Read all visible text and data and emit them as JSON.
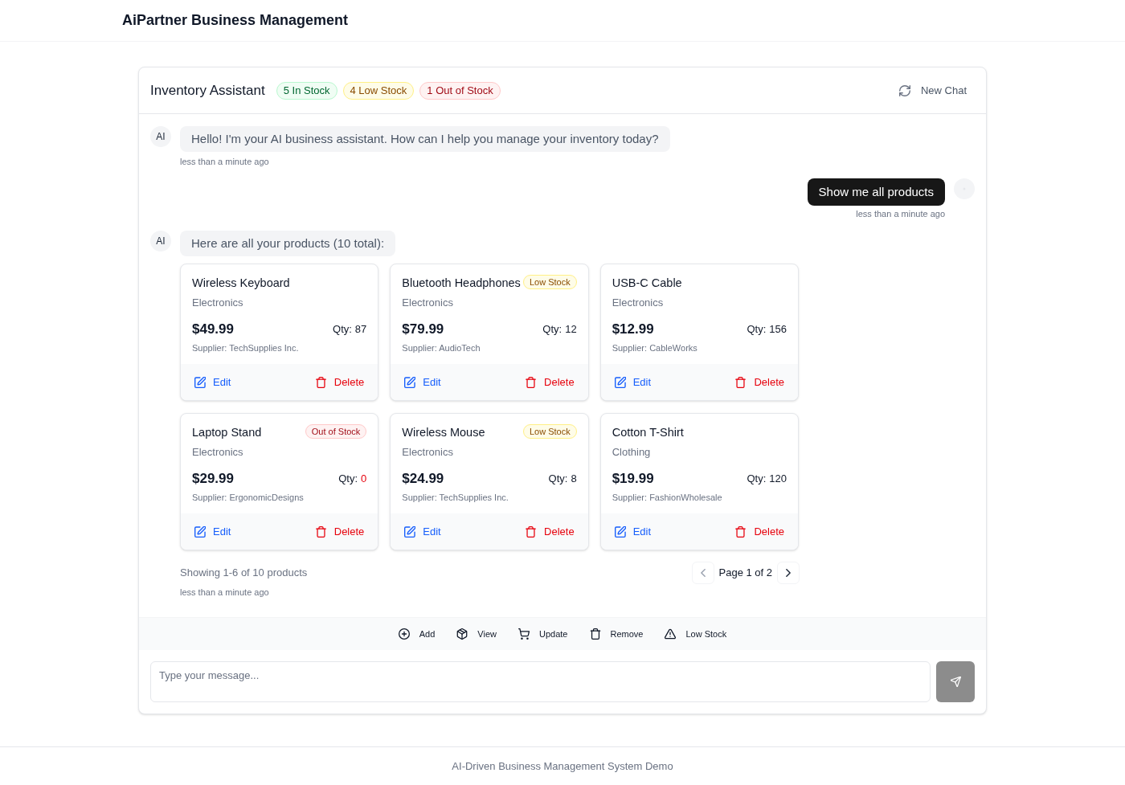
{
  "header": {
    "title": "AiPartner Business Management"
  },
  "chat": {
    "title": "Inventory Assistant",
    "stats": [
      {
        "kind": "in_stock",
        "label": "5 In Stock"
      },
      {
        "kind": "low_stock",
        "label": "4 Low Stock"
      },
      {
        "kind": "out_of_stock",
        "label": "1 Out of Stock"
      }
    ],
    "new_chat": {
      "label": "New Chat"
    }
  },
  "messages": [
    {
      "kind": "assistant",
      "avatar": "AI",
      "text": "Hello! I'm your AI business assistant. How can I help you manage your inventory today?",
      "time": "less than a minute ago"
    },
    {
      "kind": "user",
      "text": "Show me all products",
      "time": "less than a minute ago"
    },
    {
      "kind": "assistant",
      "avatar": "AI",
      "text": "Here are all your products (10 total):",
      "products": [
        {
          "kind": "in_stock",
          "name": "Wireless Keyboard",
          "category": "Electronics",
          "price": "$49.99",
          "qty_label": "Qty:",
          "qty": "87",
          "supplier": "Supplier: TechSupplies Inc.",
          "edit": "Edit",
          "delete": "Delete"
        },
        {
          "kind": "low_stock",
          "name": "Bluetooth Headphones",
          "badge": "Low Stock",
          "category": "Electronics",
          "price": "$79.99",
          "qty_label": "Qty:",
          "qty": "12",
          "supplier": "Supplier: AudioTech",
          "edit": "Edit",
          "delete": "Delete"
        },
        {
          "kind": "in_stock",
          "name": "USB-C Cable",
          "category": "Electronics",
          "price": "$12.99",
          "qty_label": "Qty:",
          "qty": "156",
          "supplier": "Supplier: CableWorks",
          "edit": "Edit",
          "delete": "Delete"
        },
        {
          "kind": "out_of_stock",
          "name": "Laptop Stand",
          "badge": "Out of Stock",
          "category": "Electronics",
          "price": "$29.99",
          "qty_label": "Qty:",
          "qty": "0",
          "supplier": "Supplier: ErgonomicDesigns",
          "edit": "Edit",
          "delete": "Delete"
        },
        {
          "kind": "low_stock",
          "name": "Wireless Mouse",
          "badge": "Low Stock",
          "category": "Electronics",
          "price": "$24.99",
          "qty_label": "Qty:",
          "qty": "8",
          "supplier": "Supplier: TechSupplies Inc.",
          "edit": "Edit",
          "delete": "Delete"
        },
        {
          "kind": "in_stock",
          "name": "Cotton T-Shirt",
          "category": "Clothing",
          "price": "$19.99",
          "qty_label": "Qty:",
          "qty": "120",
          "supplier": "Supplier: FashionWholesale",
          "edit": "Edit",
          "delete": "Delete"
        }
      ],
      "summary": "Showing 1-6 of 10 products",
      "pagination": {
        "label": "Page 1 of 2",
        "prev_disabled": true,
        "next_disabled": false
      },
      "time": "less than a minute ago"
    }
  ],
  "quick_actions": [
    {
      "kind": "add",
      "label": "Add"
    },
    {
      "kind": "view",
      "label": "View"
    },
    {
      "kind": "update",
      "label": "Update"
    },
    {
      "kind": "remove",
      "label": "Remove"
    },
    {
      "kind": "low_stock",
      "label": "Low Stock"
    }
  ],
  "composer": {
    "placeholder": "Type your message...",
    "send_disabled": true
  },
  "footer": {
    "text": "AI-Driven Business Management System Demo"
  }
}
